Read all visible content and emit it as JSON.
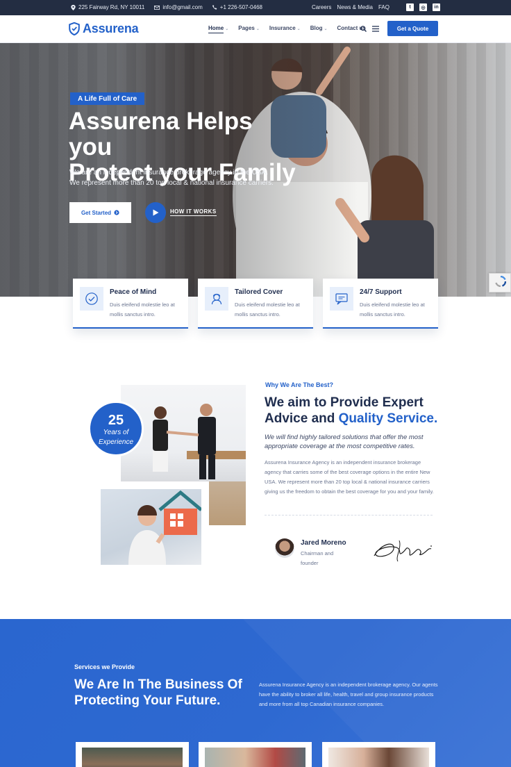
{
  "topbar": {
    "address": "225 Fairway Rd, NY 10011",
    "email": "info@gmail.com",
    "phone": "+1 226-507-0468",
    "links": [
      "Careers",
      "News & Media",
      "FAQ"
    ]
  },
  "nav": {
    "brand": "Assurena",
    "items": [
      {
        "label": "Home",
        "dropdown": true
      },
      {
        "label": "Pages",
        "dropdown": true
      },
      {
        "label": "Insurance",
        "dropdown": true
      },
      {
        "label": "Blog",
        "dropdown": true
      },
      {
        "label": "Contact us",
        "dropdown": false
      }
    ],
    "cta": "Get a Quote"
  },
  "hero": {
    "tag": "A Life Full of Care",
    "title_line1": "Assurena Helps you",
    "title_line2": "Protect your Family",
    "text": "We are an independent insurance brokerage agency in the USA. We represent more than 20 top local & national insurance carriers.",
    "primary_btn": "Get Started",
    "video_link": "HOW IT WORKS"
  },
  "features": [
    {
      "title": "Peace of Mind",
      "text": "Duis eleifend molestie leo at mollis sanctus intro.",
      "icon": "check-circle-icon"
    },
    {
      "title": "Tailored Cover",
      "text": "Duis eleifend molestie leo at mollis sanctus intro.",
      "icon": "person-icon"
    },
    {
      "title": "24/7 Support",
      "text": "Duis eleifend molestie leo at mollis sanctus intro.",
      "icon": "chat-icon"
    }
  ],
  "about": {
    "years": "25",
    "years_label_1": "Years of",
    "years_label_2": "Experience",
    "eyebrow": "Why We Are The Best?",
    "heading_part1": "We aim to Provide Expert Advice and ",
    "heading_highlight": "Quality Service.",
    "lead": "We will find highly tailored solutions that offer the most appropriate coverage at the most competitive rates.",
    "body": "Assurena Insurance Agency is an independent insurance brokerage agency that carries some of the best coverage options in the entire New USA. We represent more than 20 top local & national insurance carriers giving us the freedom to obtain the best coverage for you and your family.",
    "person_name": "Jared Moreno",
    "person_role": "Chairman and founder"
  },
  "services": {
    "eyebrow": "Services we Provide",
    "heading": "We Are In The Business Of Protecting Your Future.",
    "text": "Assurena Insurance Agency is an independent brokerage agency. Our agents have the ability to broker all life, health, travel and group insurance products and more from all top Canadian insurance companies."
  },
  "colors": {
    "accent": "#2361c9",
    "dark": "#232d42",
    "heading": "#1f2d4e"
  }
}
